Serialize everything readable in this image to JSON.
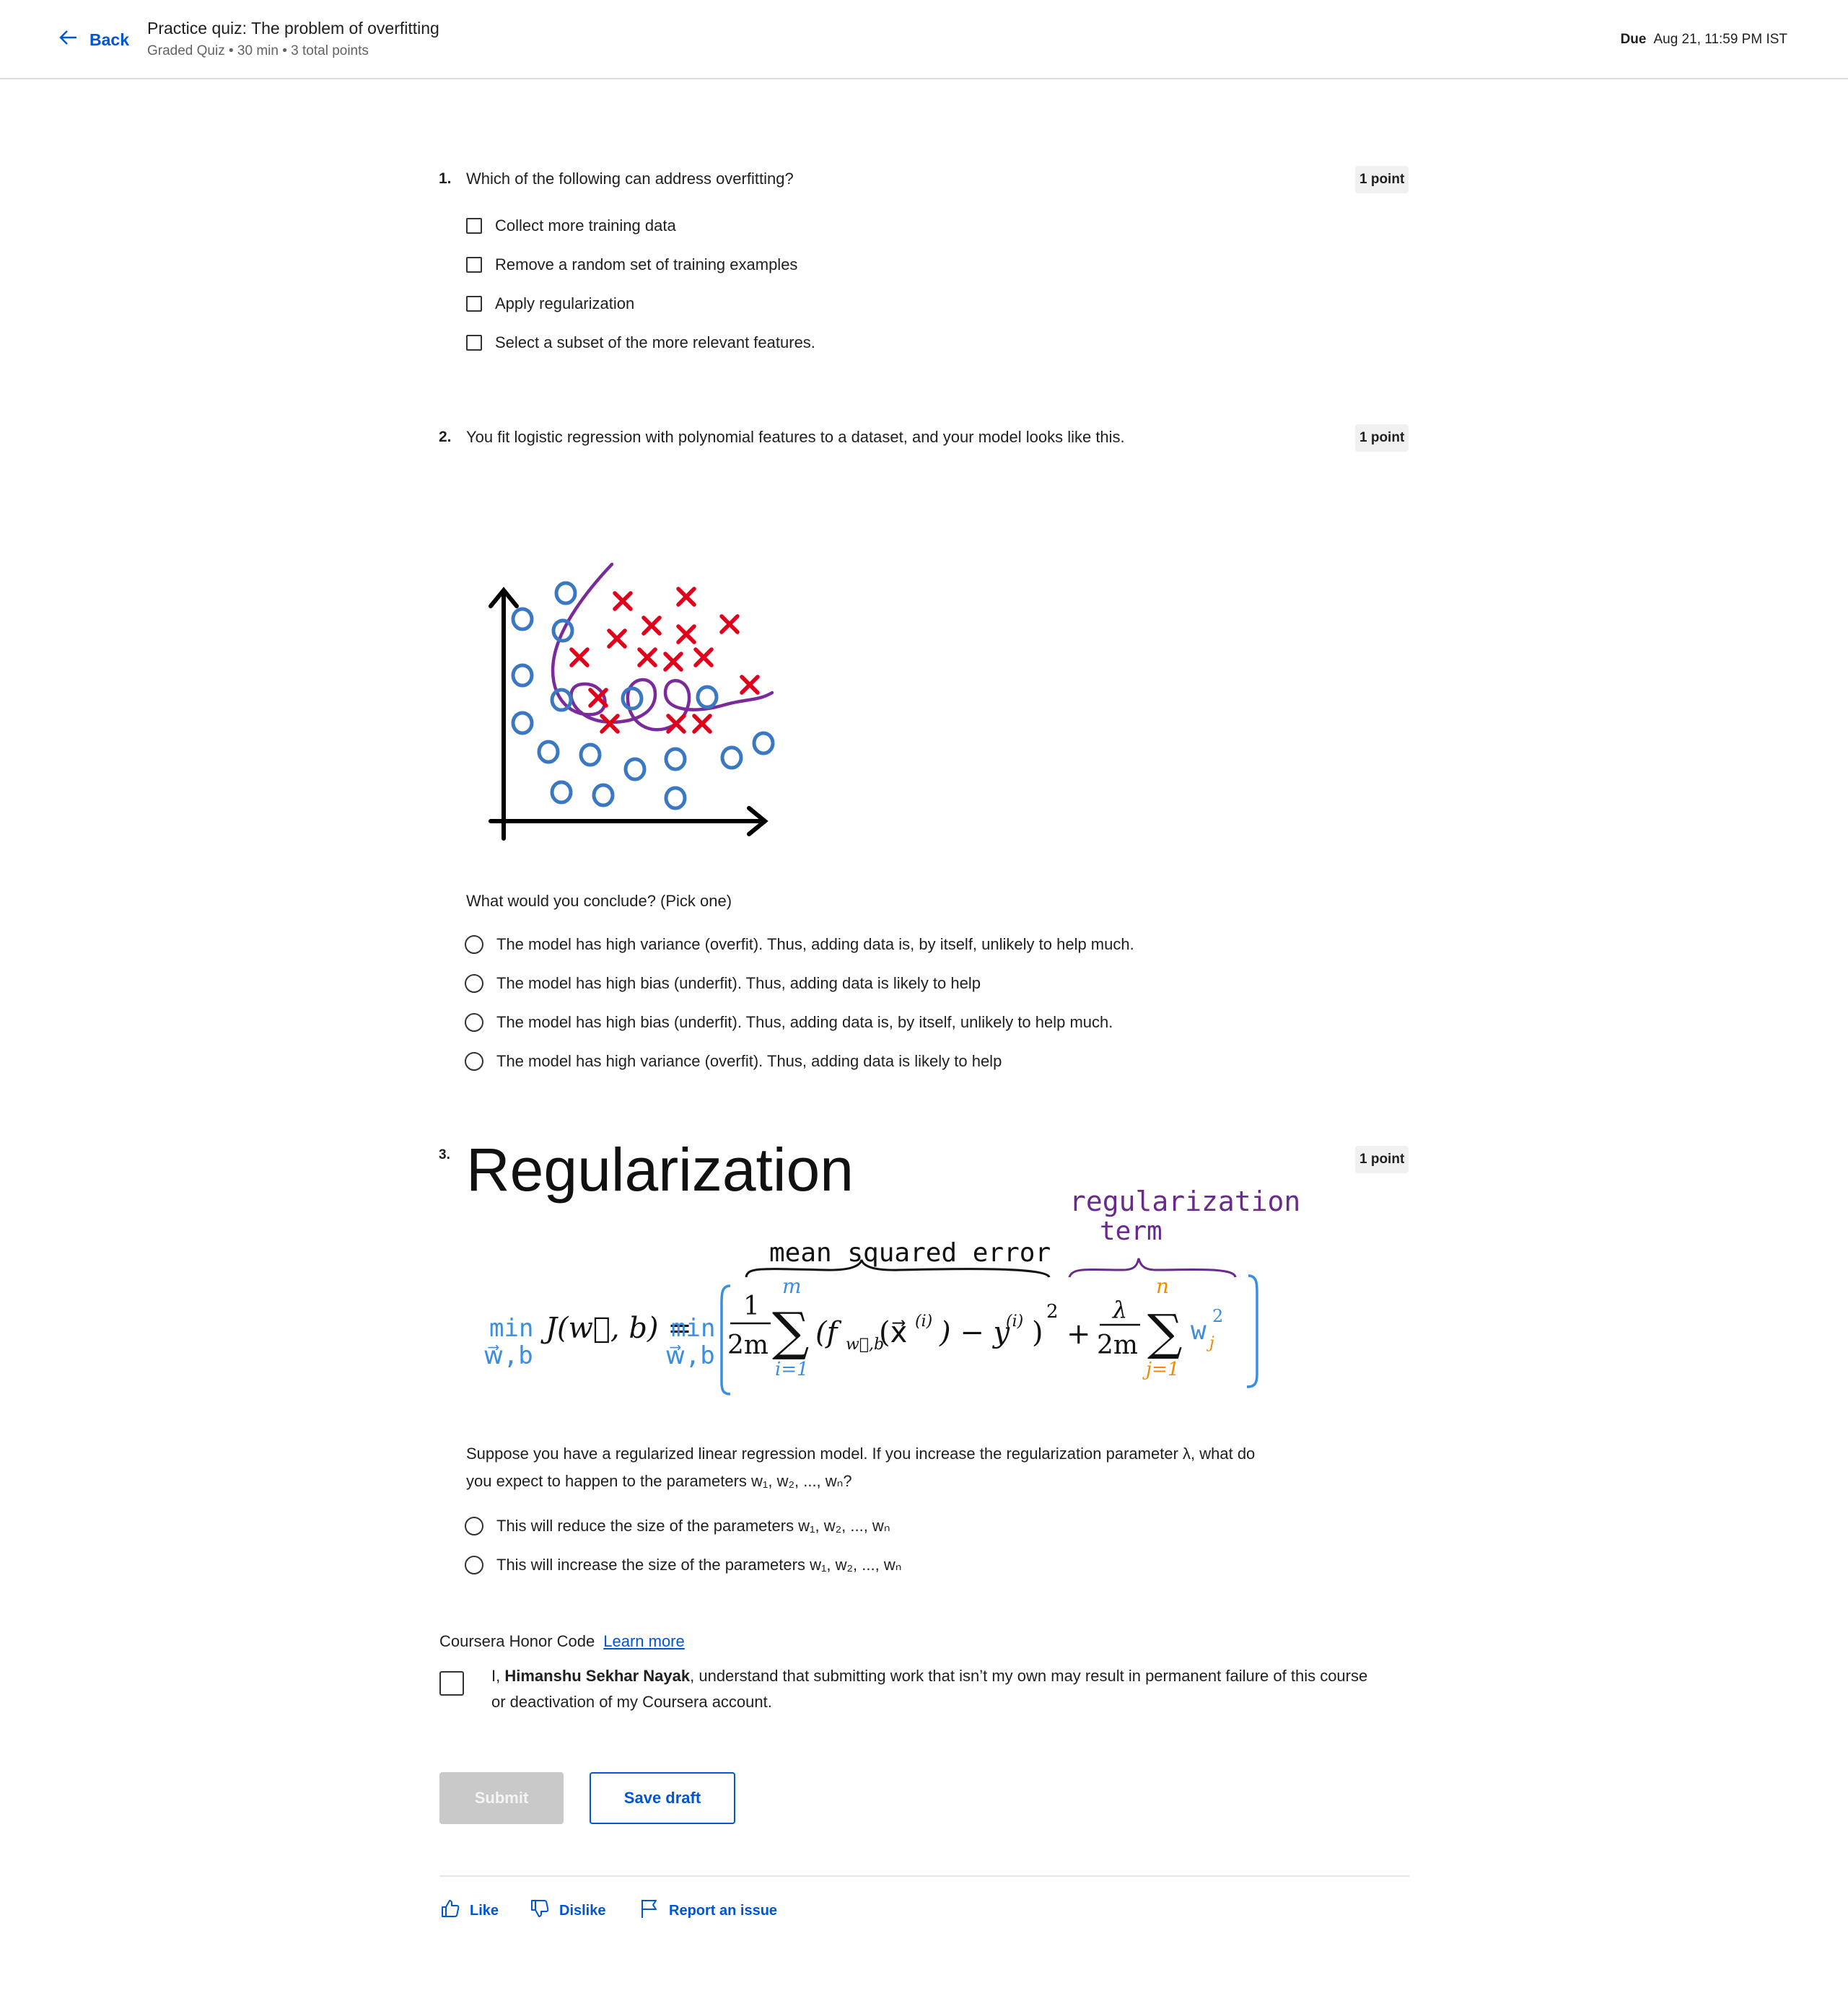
{
  "header": {
    "back_label": "Back",
    "title": "Practice quiz: The problem of overfitting",
    "subtitle": "Graded Quiz • 30 min • 3 total points",
    "due_label": "Due",
    "due_date": "Aug 21, 11:59 PM IST"
  },
  "q1": {
    "number": "1.",
    "text": "Which of the following can address overfitting?",
    "points": "1 point",
    "options": [
      "Collect more training data",
      "Remove a random set of training examples",
      "Apply regularization",
      "Select a subset of the more relevant features."
    ]
  },
  "q2": {
    "number": "2.",
    "text": "You fit logistic regression with polynomial features to a dataset, and your model looks like this.",
    "points": "1 point",
    "prompt": "What would you conclude? (Pick one)",
    "options": [
      "The model has high variance (overfit). Thus, adding data is, by itself, unlikely to help much.",
      "The model has high bias (underfit). Thus, adding data is likely to help",
      "The model has high bias (underfit). Thus, adding data is, by itself, unlikely to help much.",
      "The model has high variance (overfit). Thus, adding data is likely to help"
    ]
  },
  "q3": {
    "number": "3.",
    "points": "1 point",
    "image": {
      "heading": "Regularization",
      "reg_label_1": "regularization",
      "reg_label_2": "term",
      "mse_label": "mean squared error",
      "min_word": "min",
      "min_sub": "w⃗,b",
      "J_expr": "J(w⃗, b) =",
      "frac_num": "1",
      "frac_den": "2m",
      "sum_top": "m",
      "sum_bottom": "i=1",
      "sum_body": "(f",
      "f_sub": "w⃗,b",
      "f_arg": "(x⃗",
      "sup_i": "(i)",
      "minus_y": ") − y",
      "close_sq": ")",
      "square": "2",
      "plus": "+",
      "lambda": "λ",
      "reg_den": "2m",
      "reg_sum_top": "n",
      "reg_sum_bottom": "j=1",
      "wj": "w",
      "wj_sub": "j",
      "wj_sup": "2"
    },
    "text_line1": "Suppose you have a regularized linear regression model.  If you increase the regularization parameter λ, what do",
    "text_line2": "you expect to happen to the parameters w₁, w₂, ..., wₙ?",
    "options": [
      "This will reduce the size of the parameters w₁, w₂, ..., wₙ",
      "This will increase the size of the parameters w₁, w₂, ..., wₙ"
    ]
  },
  "honor": {
    "title": "Coursera Honor Code",
    "learn_more": "Learn more",
    "text_prefix": "I, ",
    "name": "Himanshu Sekhar Nayak",
    "text_rest": ", understand that submitting work that isn’t my own may result in permanent failure of this course",
    "text_line2": "or deactivation of my Coursera account."
  },
  "actions": {
    "submit": "Submit",
    "save_draft": "Save draft"
  },
  "footer": {
    "like": "Like",
    "dislike": "Dislike",
    "report": "Report an issue"
  },
  "colors": {
    "accent": "#0056d2",
    "cross": "#e0001b",
    "circle": "#3a78c2",
    "boundary": "#7b2a9c",
    "reg_purple": "#6a2a8c",
    "math_blue": "#3a8ee0",
    "math_orange": "#f08a00"
  },
  "icons": {
    "back": "arrow-left-icon",
    "like": "thumbs-up-icon",
    "dislike": "thumbs-down-icon",
    "report": "flag-icon"
  }
}
